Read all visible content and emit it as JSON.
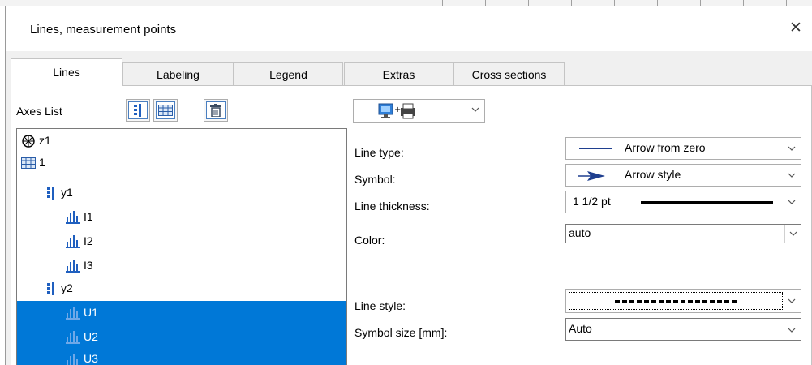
{
  "dialog": {
    "title": "Lines, measurement points",
    "close_glyph": "✕"
  },
  "tabs": [
    {
      "label": "Lines",
      "active": true
    },
    {
      "label": "Labeling",
      "active": false
    },
    {
      "label": "Legend",
      "active": false
    },
    {
      "label": "Extras",
      "active": false
    },
    {
      "label": "Cross sections",
      "active": false
    }
  ],
  "axes_list": {
    "label": "Axes List",
    "toolbar_icons": [
      "y-axis-icon",
      "table-icon",
      "trash-icon"
    ],
    "tree": [
      {
        "label": "z1",
        "icon": "polar-axis-icon",
        "level": 0,
        "selected": false
      },
      {
        "label": "1",
        "icon": "table-icon",
        "level": 0,
        "selected": false
      },
      {
        "label": "y1",
        "icon": "y-axis-icon",
        "level": 1,
        "selected": false
      },
      {
        "label": "I1",
        "icon": "channel-icon",
        "level": 2,
        "selected": false
      },
      {
        "label": "I2",
        "icon": "channel-icon",
        "level": 2,
        "selected": false
      },
      {
        "label": "I3",
        "icon": "channel-icon",
        "level": 2,
        "selected": false
      },
      {
        "label": "y2",
        "icon": "y-axis-icon",
        "level": 1,
        "selected": false
      },
      {
        "label": "U1",
        "icon": "channel-icon",
        "level": 2,
        "selected": true
      },
      {
        "label": "U2",
        "icon": "channel-icon",
        "level": 2,
        "selected": true
      },
      {
        "label": "U3",
        "icon": "channel-icon",
        "level": 2,
        "selected": true
      }
    ]
  },
  "output_dropdown": {
    "icon": "screen-printer-icon"
  },
  "properties": {
    "line_type": {
      "label": "Line type:",
      "value": "Arrow from zero",
      "preview": "solid-line"
    },
    "symbol": {
      "label": "Symbol:",
      "value": "Arrow style",
      "preview": "arrow-symbol"
    },
    "line_thickness": {
      "label": "Line thickness:",
      "value": "1  1/2 pt",
      "preview": "thick-line"
    },
    "color": {
      "label": "Color:",
      "value": "auto"
    },
    "line_style": {
      "label": "Line style:",
      "value": "",
      "preview": "dashed-line"
    },
    "symbol_size": {
      "label": "Symbol size [mm]:",
      "value": "Auto"
    }
  },
  "colors": {
    "selection": "#0078d7",
    "icon_blue": "#1f5fbf",
    "dialog_bg": "#f0f0f0"
  }
}
